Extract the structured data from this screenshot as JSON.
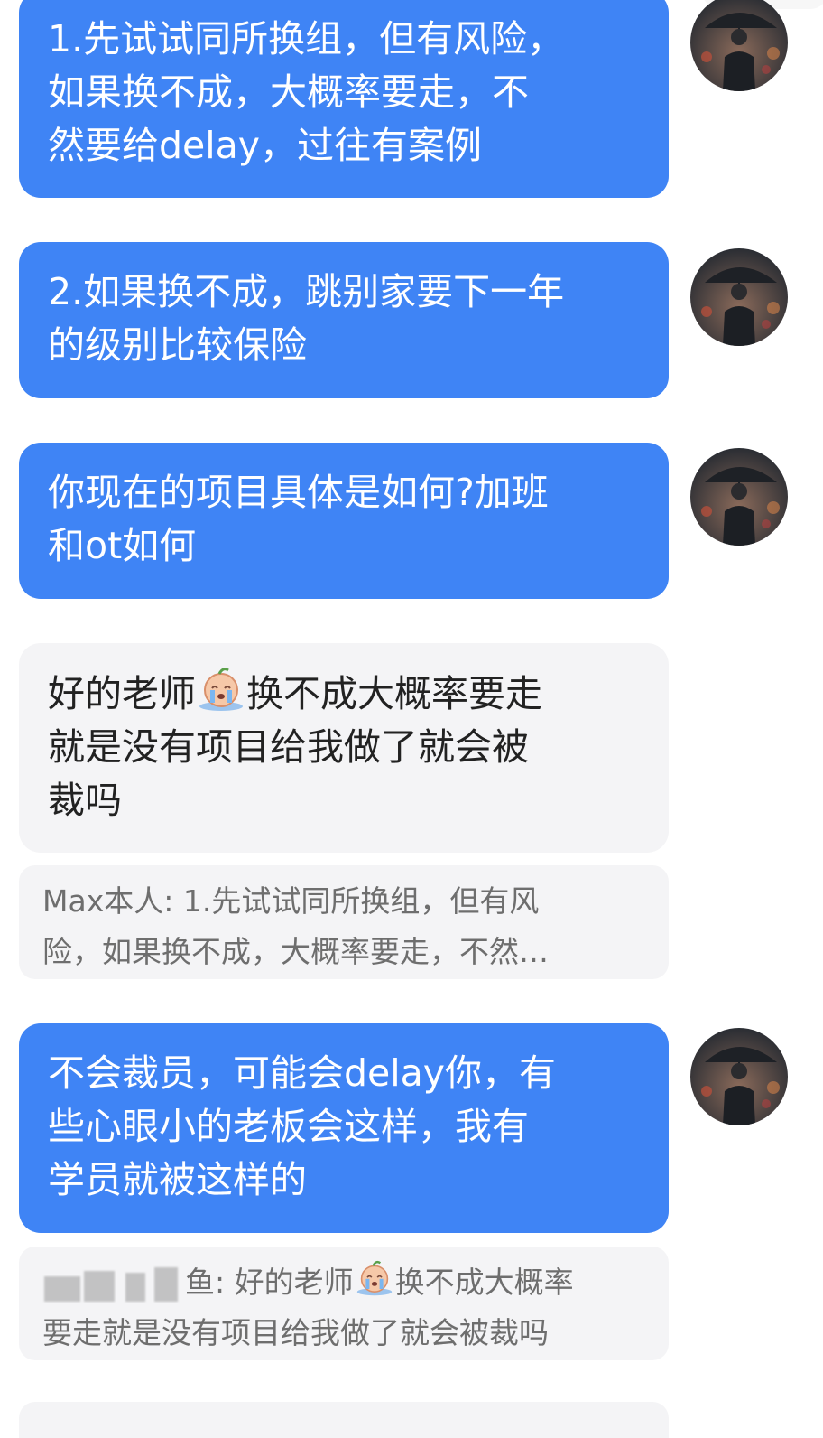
{
  "messages": [
    {
      "lines": [
        "1.先试试同所换组，但有风险，",
        "如果换不成，大概率要走，不",
        "然要给delay，过往有案例"
      ]
    },
    {
      "lines": [
        "2.如果换不成，跳别家要下一年",
        "的级别比较保险"
      ]
    },
    {
      "lines": [
        "你现在的项目具体是如何?加班",
        "和ot如何"
      ]
    },
    {
      "line1_a": "好的老师",
      "line1_b": "换不成大概率要走",
      "line2": "就是没有项目给我做了就会被",
      "line3": "裁吗"
    },
    {
      "line1": "Max本人: 1.先试试同所换组，但有风",
      "line2": "险，如果换不成，大概率要走，不然…"
    },
    {
      "lines": [
        "不会裁员，可能会delay你，有",
        "些心眼小的老板会这样，我有",
        "学员就被这样的"
      ]
    },
    {
      "line1_a": "鱼: 好的老师",
      "line1_b": "换不成大概率",
      "line2": "要走就是没有项目给我做了就会被裁吗"
    }
  ],
  "colors": {
    "sent_bubble": "#3f84f5",
    "recv_bubble": "#f4f4f6"
  },
  "icons": {
    "avatar": "person-with-umbrella-avatar",
    "emoji": "crying-face-emoji"
  }
}
